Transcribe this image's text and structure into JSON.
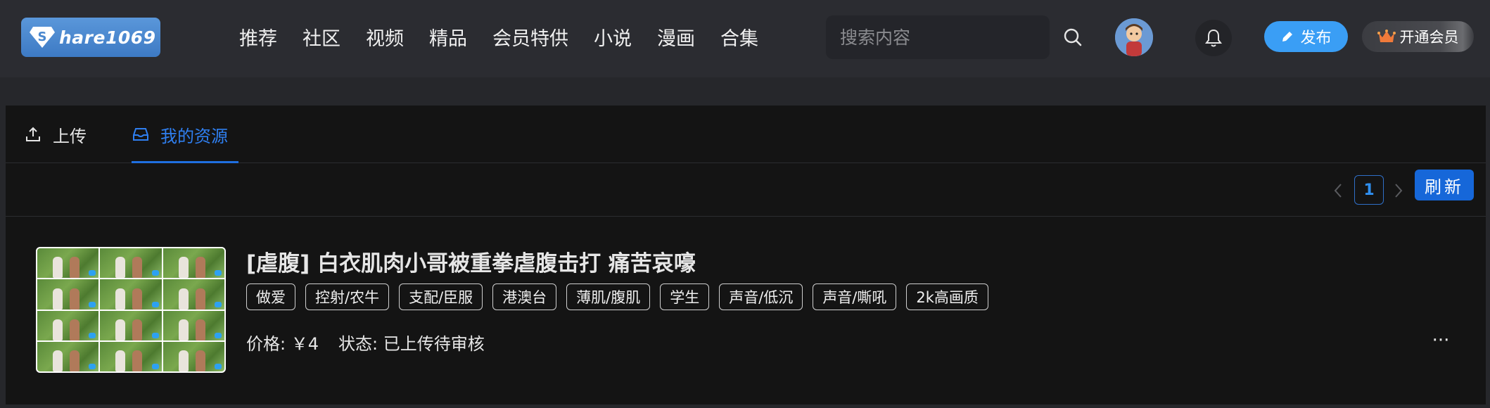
{
  "header": {
    "logo_text": "hare1069",
    "nav_items": [
      "推荐",
      "社区",
      "视频",
      "精品",
      "会员特供",
      "小说",
      "漫画",
      "合集"
    ],
    "search_placeholder": "搜索内容",
    "publish_label": "发布",
    "vip_label": "开通会员"
  },
  "tabs": {
    "upload_label": "上传",
    "resources_label": "我的资源"
  },
  "pagination": {
    "current_page": "1",
    "refresh_label": "刷新"
  },
  "resource": {
    "title": "[虐腹] 白衣肌肉小哥被重拳虐腹击打 痛苦哀嚎",
    "tags": [
      "做爱",
      "控射/农牛",
      "支配/臣服",
      "港澳台",
      "薄肌/腹肌",
      "学生",
      "声音/低沉",
      "声音/嘶吼",
      "2k高画质"
    ],
    "price_label": "价格:",
    "price_value": "￥4",
    "status_label": "状态:",
    "status_value": "已上传待审核",
    "more_label": "···"
  },
  "colors": {
    "accent": "#1667d9",
    "active_tab": "#2f7ff0",
    "publish": "#3a9ef5",
    "logo": "#4a88cf"
  }
}
